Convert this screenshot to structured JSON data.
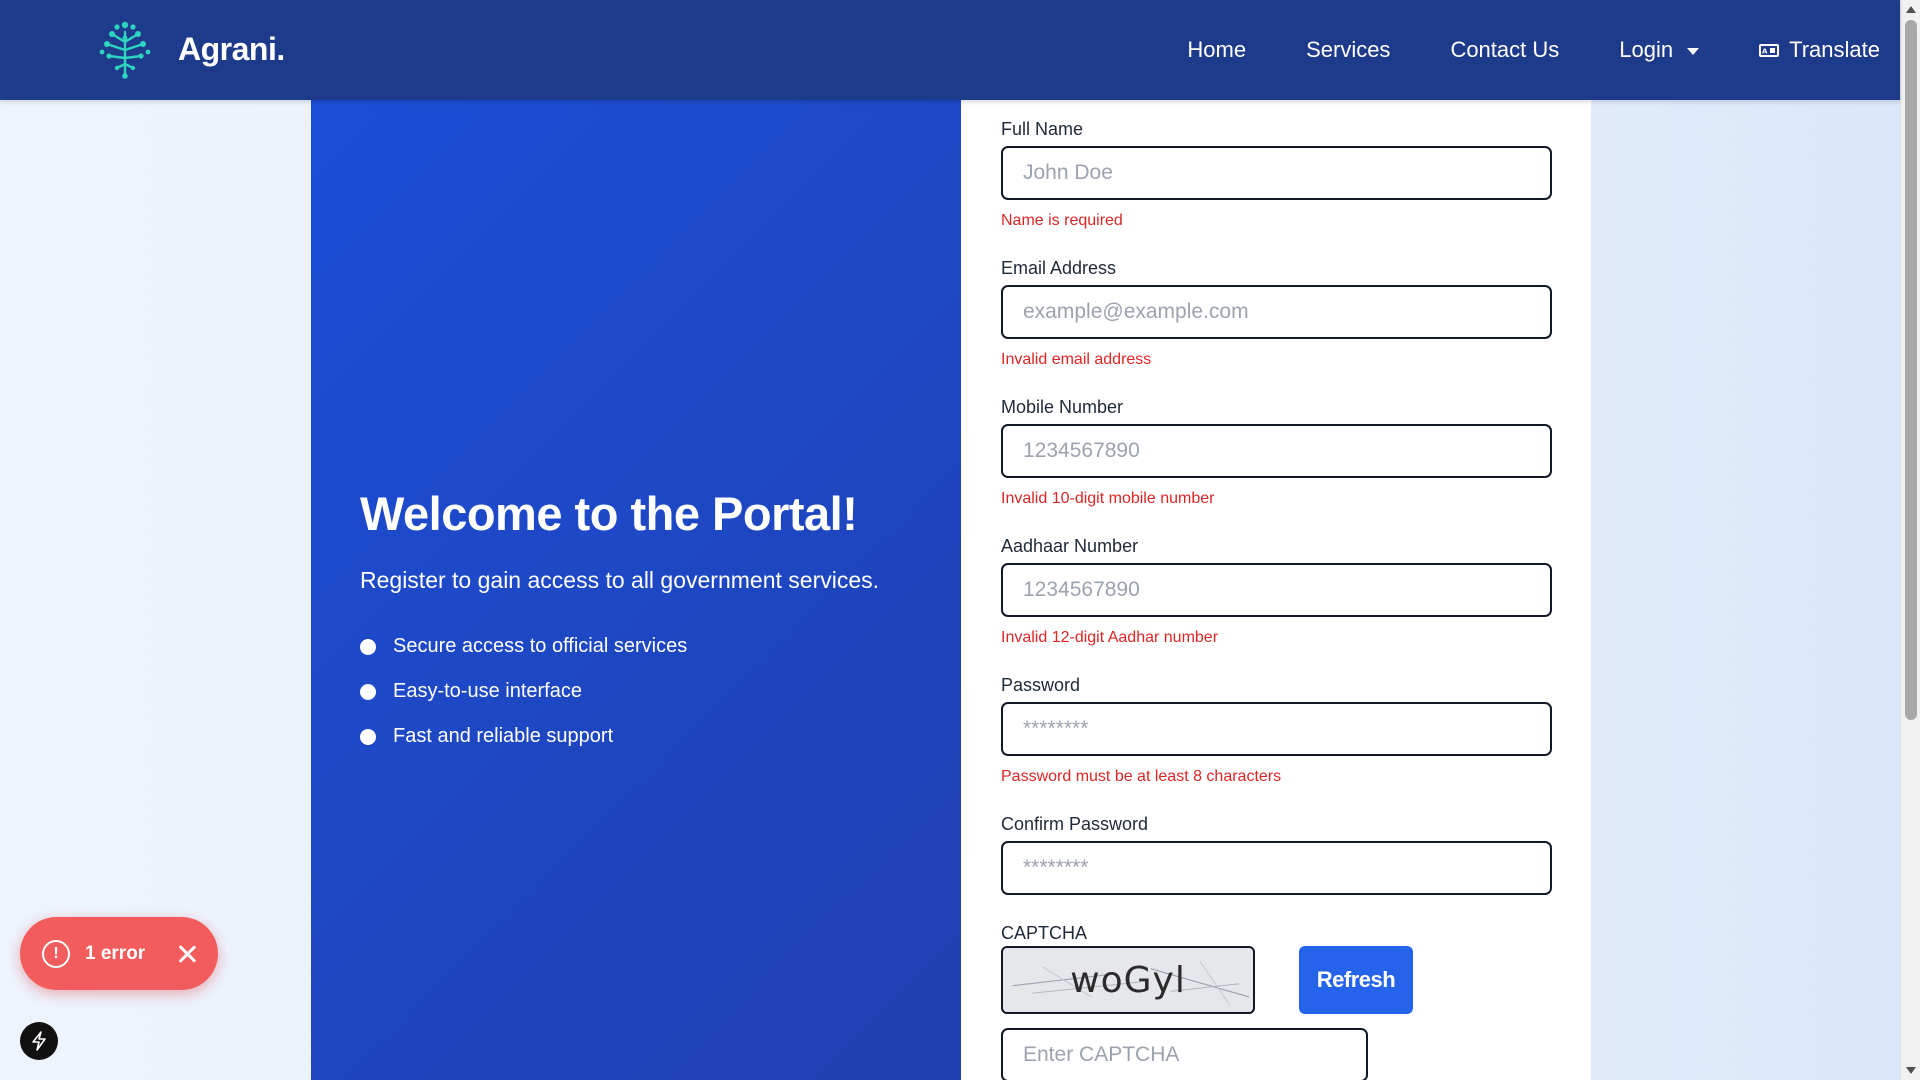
{
  "navbar": {
    "brand_name": "Agrani.",
    "links": {
      "home": "Home",
      "services": "Services",
      "contact": "Contact Us",
      "login": "Login",
      "translate": "Translate"
    },
    "background_color": "#1e3a8a",
    "logo_color": "#2dd4bf"
  },
  "welcome": {
    "title": "Welcome to the Portal!",
    "subtitle": "Register to gain access to all government services.",
    "features": [
      "Secure access to official services",
      "Easy-to-use interface",
      "Fast and reliable support"
    ],
    "panel_color": "#1d4ed8"
  },
  "form": {
    "fields": [
      {
        "label": "Full Name",
        "placeholder": "John Doe",
        "value": "",
        "error": "Name is required"
      },
      {
        "label": "Email Address",
        "placeholder": "example@example.com",
        "value": "",
        "error": "Invalid email address"
      },
      {
        "label": "Mobile Number",
        "placeholder": "1234567890",
        "value": "",
        "error": "Invalid 10-digit mobile number"
      },
      {
        "label": "Aadhaar Number",
        "placeholder": "1234567890",
        "value": "",
        "error": "Invalid 12-digit Aadhar number"
      },
      {
        "label": "Password",
        "placeholder": "********",
        "value": "",
        "error": "Password must be at least 8 characters"
      },
      {
        "label": "Confirm Password",
        "placeholder": "********",
        "value": "",
        "error": ""
      }
    ],
    "captcha": {
      "label": "CAPTCHA",
      "code": "woGyl",
      "refresh_label": "Refresh",
      "input_placeholder": "Enter CAPTCHA",
      "input_value": ""
    },
    "error_color": "#dc2626",
    "button_color": "#2563eb"
  },
  "toast": {
    "text": "1 error",
    "color": "#f25c5c"
  }
}
